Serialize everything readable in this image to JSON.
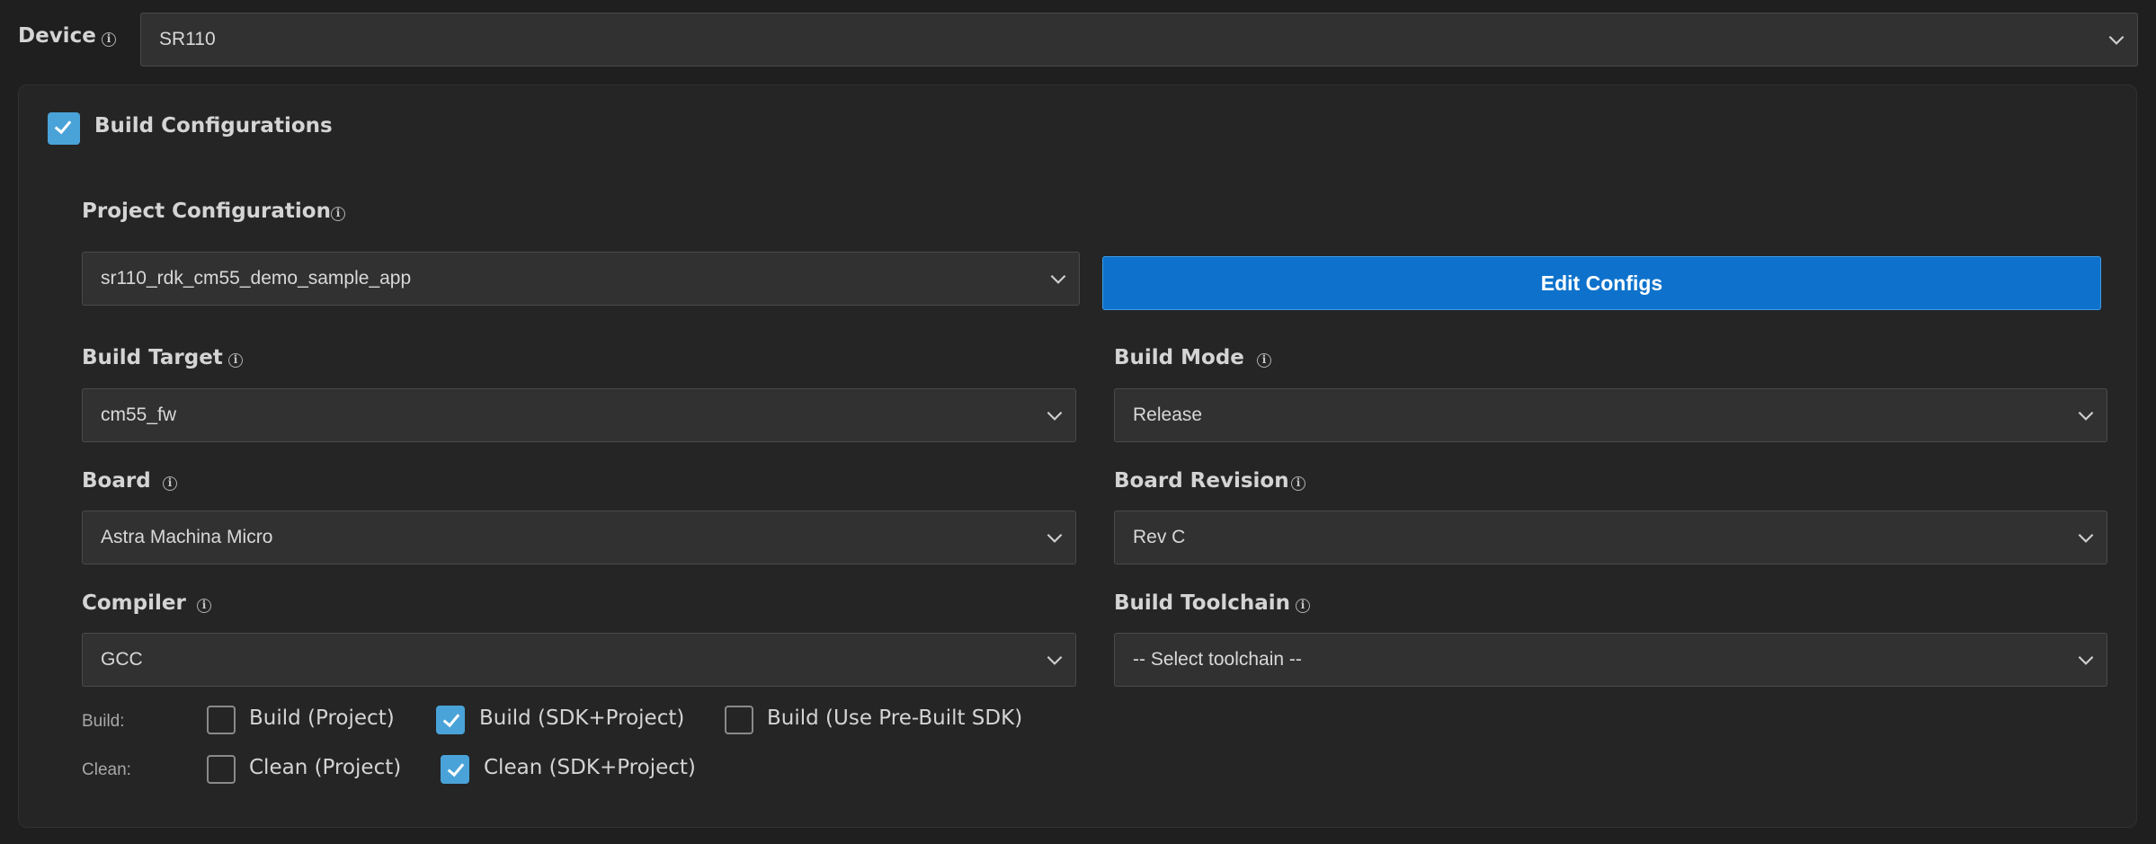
{
  "device": {
    "label": "Device",
    "value": "SR110"
  },
  "build_configurations": {
    "label": "Build Configurations",
    "enabled": true
  },
  "project_configuration": {
    "label": "Project Configuration",
    "value": "sr110_rdk_cm55_demo_sample_app"
  },
  "edit_configs_button": {
    "label": "Edit Configs"
  },
  "build_target": {
    "label": "Build Target",
    "value": "cm55_fw"
  },
  "build_mode": {
    "label": "Build Mode",
    "value": "Release"
  },
  "board": {
    "label": "Board",
    "value": "Astra Machina Micro"
  },
  "board_revision": {
    "label": "Board Revision",
    "value": "Rev C"
  },
  "compiler": {
    "label": "Compiler",
    "value": "GCC"
  },
  "build_toolchain": {
    "label": "Build Toolchain",
    "value": "-- Select toolchain --"
  },
  "build_options": {
    "label": "Build:",
    "options": [
      {
        "label": "Build (Project)",
        "checked": false
      },
      {
        "label": "Build (SDK+Project)",
        "checked": true
      },
      {
        "label": "Build (Use Pre-Built SDK)",
        "checked": false
      }
    ]
  },
  "clean_options": {
    "label": "Clean:",
    "options": [
      {
        "label": "Clean (Project)",
        "checked": false
      },
      {
        "label": "Clean (SDK+Project)",
        "checked": true
      }
    ]
  },
  "colors": {
    "accent": "#0e72cc",
    "checkbox_checked": "#4aa3d8",
    "background": "#1f1f1f",
    "panel": "#252526"
  }
}
